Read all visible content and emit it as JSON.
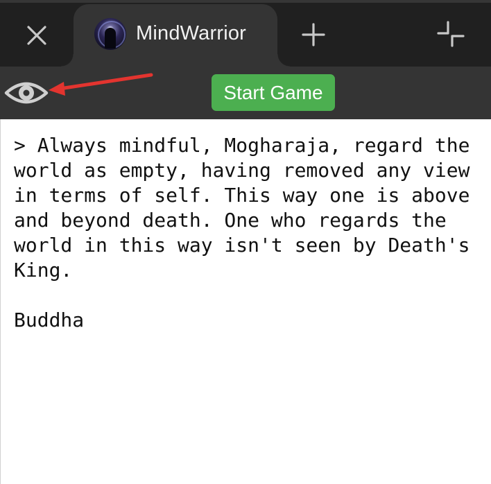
{
  "tab": {
    "title": "MindWarrior",
    "favicon": "mind-warrior-avatar",
    "close_icon": "close-icon",
    "new_tab_icon": "plus-icon",
    "minimize_icon": "minimize-corner-icon"
  },
  "toolbar": {
    "eye_icon": "eye-icon",
    "start_label": "Start Game",
    "start_color": "#4caf50",
    "annotation_color": "#e3342f"
  },
  "console": {
    "quote": "> Always mindful, Mogharaja, regard the world as empty, having removed any view in terms of self. This way one is above and beyond death. One who regards the world in this way isn't seen by Death's King.",
    "attribution": "Buddha"
  }
}
